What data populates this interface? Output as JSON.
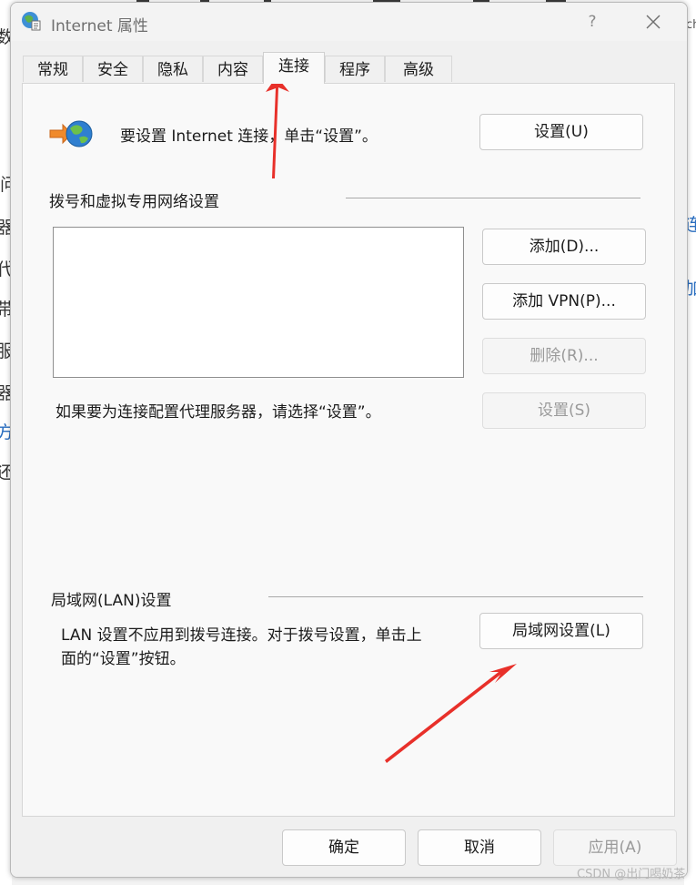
{
  "window": {
    "title": "Internet 属性",
    "help_label": "?",
    "close_label": "✕"
  },
  "tabs": [
    {
      "label": "常规"
    },
    {
      "label": "安全"
    },
    {
      "label": "隐私"
    },
    {
      "label": "内容"
    },
    {
      "label": "连接",
      "active": true
    },
    {
      "label": "程序"
    },
    {
      "label": "高级"
    }
  ],
  "setup": {
    "text": "要设置 Internet 连接，单击“设置”。",
    "button": "设置(U)"
  },
  "dialup": {
    "heading": "拨号和虚拟专用网络设置",
    "add_button": "添加(D)...",
    "add_vpn_button": "添加 VPN(P)...",
    "remove_button": "删除(R)...",
    "proxy_text": "如果要为连接配置代理服务器，请选择“设置”。",
    "settings_button": "设置(S)"
  },
  "lan": {
    "heading": "局域网(LAN)设置",
    "text_line1": "LAN 设置不应用到拨号连接。对于拨号设置，单击上",
    "text_line2": "面的“设置”按钮。",
    "button": "局域网设置(L)"
  },
  "footer": {
    "ok": "确定",
    "cancel": "取消",
    "apply": "应用(A)"
  },
  "background": {
    "left_chars": [
      "数",
      "问",
      "器",
      "代",
      "带",
      "服",
      "器",
      "方",
      "还"
    ],
    "right_chars": [
      "ch",
      "连接",
      "加载"
    ]
  },
  "watermark": "CSDN @出门喝奶茶",
  "colors": {
    "annotation_arrow": "#e8302a",
    "accent_link": "#2a6ec0"
  }
}
